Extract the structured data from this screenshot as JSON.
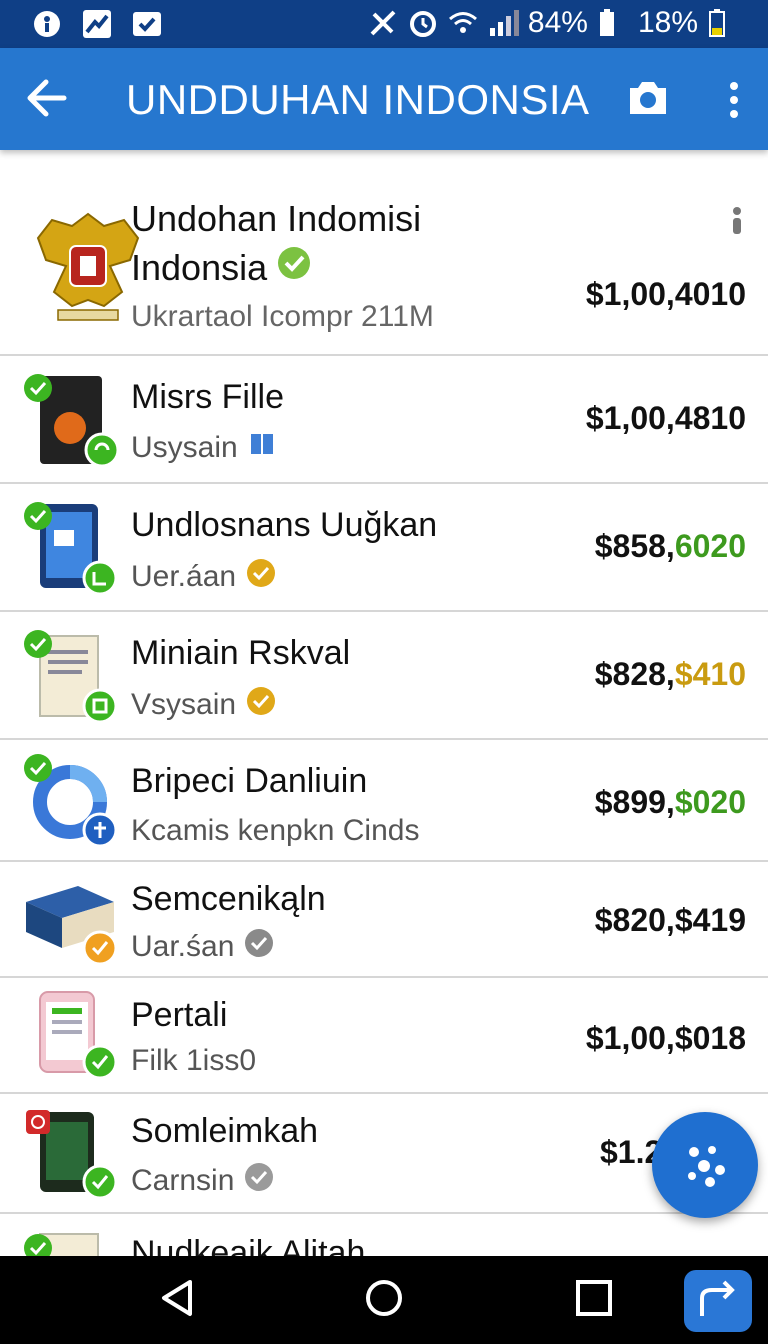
{
  "status_bar": {
    "battery_1": "84%",
    "battery_2": "18%"
  },
  "app_bar": {
    "title": "UNDDUHAN INDONSIA"
  },
  "featured": {
    "name_line1": "Undohan Indomisi",
    "name_line2": "Indonsia",
    "subtitle": "Ukrartaol Icompr 211M",
    "price": "$1,00,4010"
  },
  "items": [
    {
      "name": "Misrs Fille",
      "subtitle": "Usysain",
      "price": "$1,00,4810",
      "price_main": "$1,00,4810",
      "price_accent": "",
      "accent_color": ""
    },
    {
      "name": "Undlosnans Uuğkan",
      "subtitle": "Uer.áan",
      "price_main": "$858,",
      "price_accent": "6020",
      "accent_color": "#3d9a1e"
    },
    {
      "name": "Miniain Rskval",
      "subtitle": "Vsysain",
      "price_main": "$828,",
      "price_accent": "$410",
      "accent_color": "#c99b10"
    },
    {
      "name": "Bripeci Danliuin",
      "subtitle": "Kcamis kenpkn Cinds",
      "price_main": "$899,",
      "price_accent": "$020",
      "accent_color": "#3d9a1e"
    },
    {
      "name": "Semcenikąln",
      "subtitle": "Uar.śan",
      "price_main": "$820,$419",
      "price_accent": "",
      "accent_color": "#c99b10"
    },
    {
      "name": "Pertali",
      "subtitle": "Filk 1iss0",
      "price_main": "$1,00,$018",
      "price_accent": "",
      "accent_color": "#3d9a1e"
    },
    {
      "name": "Somleimkah",
      "subtitle": "Carnsin",
      "price_main": "$1.2",
      "price_accent": "",
      "accent_color": ""
    },
    {
      "name": "Nudkeaik Alitah",
      "subtitle": "",
      "price_main": "",
      "price_accent": "",
      "accent_color": ""
    }
  ],
  "colors": {
    "status_bar": "#0f3f86",
    "app_bar": "#2677cf",
    "check_green": "#3cb521",
    "fab": "#1f6fd0"
  }
}
